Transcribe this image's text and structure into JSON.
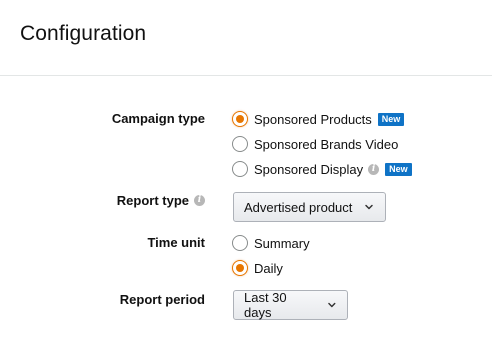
{
  "title": "Configuration",
  "campaign_type": {
    "label": "Campaign type",
    "options": [
      {
        "label": "Sponsored Products",
        "badge": "New",
        "checked": true
      },
      {
        "label": "Sponsored Brands Video",
        "badge": "",
        "checked": false
      },
      {
        "label": "Sponsored Display",
        "badge": "New",
        "checked": false
      }
    ]
  },
  "report_type": {
    "label": "Report type",
    "value": "Advertised product"
  },
  "time_unit": {
    "label": "Time unit",
    "options": [
      {
        "label": "Summary",
        "checked": false
      },
      {
        "label": "Daily",
        "checked": true
      }
    ]
  },
  "report_period": {
    "label": "Report period",
    "value": "Last 30 days"
  },
  "icons": {
    "info": "info-icon",
    "chevron": "chevron-down-icon"
  },
  "colors": {
    "accent": "#e77600",
    "badge": "#0f73c6"
  }
}
